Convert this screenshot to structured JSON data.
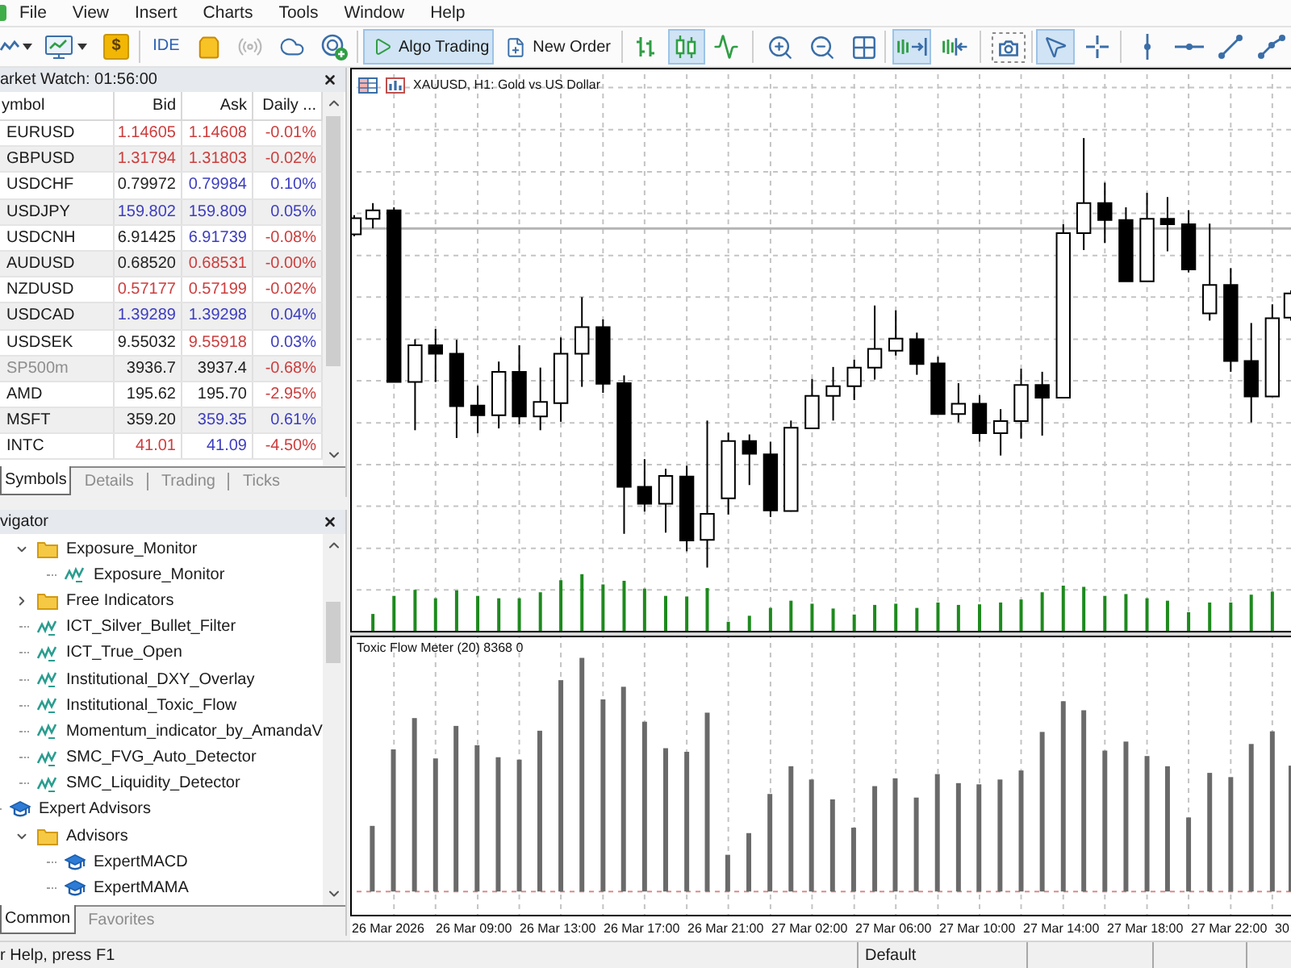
{
  "menu": [
    "File",
    "View",
    "Insert",
    "Charts",
    "Tools",
    "Window",
    "Help"
  ],
  "toolbar": {
    "market_label": "$",
    "ide_label": "IDE",
    "signals": {
      "disabled": true
    },
    "algo_trading": {
      "label": "Algo Trading",
      "on": true
    },
    "new_order": {
      "label": "New Order"
    },
    "chart_types": [
      {
        "kind": "bars",
        "selected": false
      },
      {
        "kind": "candles",
        "selected": true
      },
      {
        "kind": "line",
        "selected": false
      }
    ],
    "scroll_modes": [
      {
        "kind": "autoscroll",
        "on": true
      },
      {
        "kind": "shift",
        "on": false
      }
    ],
    "pointers": [
      {
        "kind": "cursor",
        "selected": true
      },
      {
        "kind": "crosshair",
        "selected": false
      }
    ]
  },
  "market_watch": {
    "title": "arket Watch: 01:56:00",
    "columns": [
      "ymbol",
      "Bid",
      "Ask",
      "Daily ..."
    ],
    "rows": [
      {
        "symbol": "EURUSD",
        "inactive": false,
        "bid": {
          "text": "1.14605",
          "color": "#cc3d3d"
        },
        "ask": {
          "text": "1.14608",
          "color": "#cc3d3d"
        },
        "daily_change": {
          "text": "-0.01%",
          "color": "#cc3d3d"
        }
      },
      {
        "symbol": "GBPUSD",
        "inactive": false,
        "bid": {
          "text": "1.31794",
          "color": "#cc3d3d"
        },
        "ask": {
          "text": "1.31803",
          "color": "#cc3d3d"
        },
        "daily_change": {
          "text": "-0.02%",
          "color": "#cc3d3d"
        }
      },
      {
        "symbol": "USDCHF",
        "inactive": false,
        "bid": {
          "text": "0.79972",
          "color": "#1e1e1e"
        },
        "ask": {
          "text": "0.79984",
          "color": "#3d3dbf"
        },
        "daily_change": {
          "text": "0.10%",
          "color": "#3d3dbf"
        }
      },
      {
        "symbol": "USDJPY",
        "inactive": false,
        "bid": {
          "text": "159.802",
          "color": "#3d3dbf"
        },
        "ask": {
          "text": "159.809",
          "color": "#3d3dbf"
        },
        "daily_change": {
          "text": "0.05%",
          "color": "#3d3dbf"
        }
      },
      {
        "symbol": "USDCNH",
        "inactive": false,
        "bid": {
          "text": "6.91425",
          "color": "#1e1e1e"
        },
        "ask": {
          "text": "6.91739",
          "color": "#3d3dbf"
        },
        "daily_change": {
          "text": "-0.08%",
          "color": "#cc3d3d"
        }
      },
      {
        "symbol": "AUDUSD",
        "inactive": false,
        "bid": {
          "text": "0.68520",
          "color": "#1e1e1e"
        },
        "ask": {
          "text": "0.68531",
          "color": "#cc3d3d"
        },
        "daily_change": {
          "text": "-0.00%",
          "color": "#cc3d3d"
        }
      },
      {
        "symbol": "NZDUSD",
        "inactive": false,
        "bid": {
          "text": "0.57177",
          "color": "#cc3d3d"
        },
        "ask": {
          "text": "0.57199",
          "color": "#cc3d3d"
        },
        "daily_change": {
          "text": "-0.02%",
          "color": "#cc3d3d"
        }
      },
      {
        "symbol": "USDCAD",
        "inactive": false,
        "bid": {
          "text": "1.39289",
          "color": "#3d3dbf"
        },
        "ask": {
          "text": "1.39298",
          "color": "#3d3dbf"
        },
        "daily_change": {
          "text": "0.04%",
          "color": "#3d3dbf"
        }
      },
      {
        "symbol": "USDSEK",
        "inactive": false,
        "bid": {
          "text": "9.55032",
          "color": "#1e1e1e"
        },
        "ask": {
          "text": "9.55918",
          "color": "#cc3d3d"
        },
        "daily_change": {
          "text": "0.03%",
          "color": "#3d3dbf"
        }
      },
      {
        "symbol": "SP500m",
        "inactive": true,
        "bid": {
          "text": "3936.7",
          "color": "#1e1e1e"
        },
        "ask": {
          "text": "3937.4",
          "color": "#1e1e1e"
        },
        "daily_change": {
          "text": "-0.68%",
          "color": "#cc3d3d"
        }
      },
      {
        "symbol": "AMD",
        "inactive": false,
        "bid": {
          "text": "195.62",
          "color": "#1e1e1e"
        },
        "ask": {
          "text": "195.70",
          "color": "#1e1e1e"
        },
        "daily_change": {
          "text": "-2.95%",
          "color": "#cc3d3d"
        }
      },
      {
        "symbol": "MSFT",
        "inactive": false,
        "bid": {
          "text": "359.20",
          "color": "#1e1e1e"
        },
        "ask": {
          "text": "359.35",
          "color": "#3d3dbf"
        },
        "daily_change": {
          "text": "0.61%",
          "color": "#3d3dbf"
        }
      },
      {
        "symbol": "INTC",
        "inactive": false,
        "bid": {
          "text": "41.01",
          "color": "#cc3d3d"
        },
        "ask": {
          "text": "41.09",
          "color": "#3d3dbf"
        },
        "daily_change": {
          "text": "-4.50%",
          "color": "#cc3d3d"
        }
      }
    ],
    "tabs": [
      {
        "label": "Symbols",
        "selected": true
      },
      {
        "label": "Details",
        "selected": false
      },
      {
        "label": "Trading",
        "selected": false
      },
      {
        "label": "Ticks",
        "selected": false
      }
    ]
  },
  "navigator": {
    "title": "vigator",
    "tree": [
      {
        "children": [
          {
            "label": "Exposure_Monitor",
            "kind": "folder",
            "expanded": true,
            "children": [
              {
                "label": "Exposure_Monitor",
                "kind": "indicator"
              }
            ]
          },
          {
            "label": "Free Indicators",
            "kind": "folder",
            "expanded": false
          },
          {
            "label": "ICT_Silver_Bullet_Filter",
            "kind": "indicator"
          },
          {
            "label": "ICT_True_Open",
            "kind": "indicator"
          },
          {
            "label": "Institutional_DXY_Overlay",
            "kind": "indicator"
          },
          {
            "label": "Institutional_Toxic_Flow",
            "kind": "indicator"
          },
          {
            "label": "Momentum_indicator_by_AmandaV",
            "kind": "indicator"
          },
          {
            "label": "SMC_FVG_Auto_Detector",
            "kind": "indicator"
          },
          {
            "label": "SMC_Liquidity_Detector",
            "kind": "indicator"
          }
        ]
      },
      {
        "label": "Expert Advisors",
        "kind": "expert",
        "children": [
          {
            "label": "Advisors",
            "kind": "folder",
            "expanded": true,
            "children": [
              {
                "label": "ExpertMACD",
                "kind": "expert"
              },
              {
                "label": "ExpertMAMA",
                "kind": "expert"
              }
            ]
          }
        ]
      }
    ],
    "tabs": [
      {
        "label": "Common",
        "selected": true
      },
      {
        "label": "Favorites",
        "selected": false
      }
    ]
  },
  "chart": {
    "title": "XAUUSD, H1: Gold vs US Dollar",
    "indicator_title": "Toxic Flow Meter (20) 8368 0",
    "time_axis": [
      "26 Mar 2026",
      "26 Mar 09:00",
      "26 Mar 13:00",
      "26 Mar 17:00",
      "26 Mar 21:00",
      "27 Mar 02:00",
      "27 Mar 06:00",
      "27 Mar 10:00",
      "27 Mar 14:00",
      "27 Mar 18:00",
      "27 Mar 22:00",
      "30"
    ]
  },
  "status_bar": {
    "help": "r Help, press F1",
    "profile": "Default"
  }
}
